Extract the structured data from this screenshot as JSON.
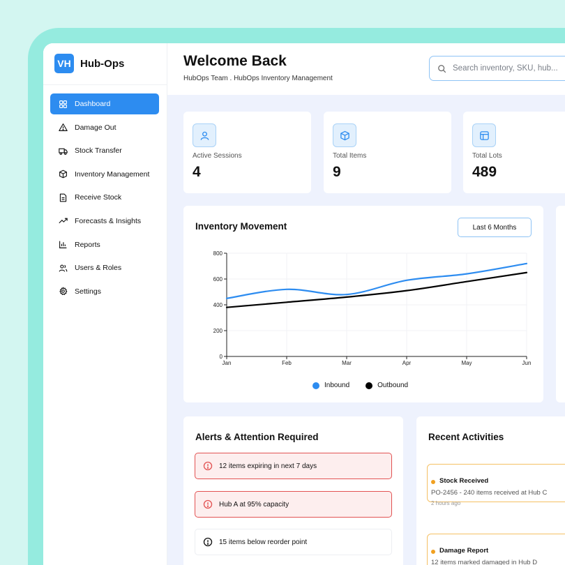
{
  "brand": {
    "logo_text": "VH",
    "name": "Hub-Ops"
  },
  "sidebar": {
    "items": [
      {
        "label": "Dashboard",
        "icon": "grid-icon",
        "active": true
      },
      {
        "label": "Damage Out",
        "icon": "warning-icon"
      },
      {
        "label": "Stock Transfer",
        "icon": "truck-icon"
      },
      {
        "label": "Inventory Management",
        "icon": "box-icon"
      },
      {
        "label": "Receive Stock",
        "icon": "document-icon"
      },
      {
        "label": "Forecasts & Insights",
        "icon": "trending-up-icon"
      },
      {
        "label": "Reports",
        "icon": "bar-chart-icon"
      },
      {
        "label": "Users & Roles",
        "icon": "users-icon"
      },
      {
        "label": "Settings",
        "icon": "gear-icon"
      }
    ]
  },
  "header": {
    "title": "Welcome Back",
    "subtitle": "HubOps Team . HubOps Inventory Management",
    "search_placeholder": "Search inventory, SKU, hub..."
  },
  "stats": [
    {
      "label": "Active Sessions",
      "value": "4",
      "icon": "user-icon"
    },
    {
      "label": "Total Items",
      "value": "9",
      "icon": "box-icon"
    },
    {
      "label": "Total Lots",
      "value": "489",
      "icon": "layout-icon"
    }
  ],
  "movement": {
    "title": "Inventory Movement",
    "range_label": "Last 6 Months"
  },
  "chart_data": {
    "type": "line",
    "categories": [
      "Jan",
      "Feb",
      "Mar",
      "Apr",
      "May",
      "Jun"
    ],
    "x": [
      "Jan",
      "Feb",
      "Mar",
      "Apr",
      "May",
      "Jun"
    ],
    "series": [
      {
        "name": "Inbound",
        "color": "#2d8cf0",
        "values": [
          450,
          520,
          480,
          590,
          640,
          720
        ]
      },
      {
        "name": "Outbound",
        "color": "#000000",
        "values": [
          380,
          420,
          460,
          510,
          580,
          650
        ]
      }
    ],
    "y_ticks": [
      0,
      200,
      400,
      600,
      800
    ],
    "ylim": [
      0,
      800
    ],
    "grid": true,
    "legend": "bottom-center",
    "title": "Inventory Movement"
  },
  "alerts": {
    "title": "Alerts & Attention Required",
    "items": [
      {
        "text": "12 items expiring in next 7 days",
        "level": "danger"
      },
      {
        "text": "Hub A at 95% capacity",
        "level": "danger"
      },
      {
        "text": "15 items below reorder point",
        "level": "info"
      }
    ]
  },
  "activities": {
    "title": "Recent Activities",
    "items": [
      {
        "title": "Stock Received",
        "desc": "PO-2456 - 240 items received at Hub C",
        "time": "2 hours ago"
      },
      {
        "title": "Damage Report",
        "desc": "12 items marked damaged in Hub D",
        "time": ""
      }
    ]
  },
  "colors": {
    "accent": "#2d8cf0",
    "danger": "#e25252",
    "warning": "#f0a020",
    "background": "#eef2fd"
  }
}
